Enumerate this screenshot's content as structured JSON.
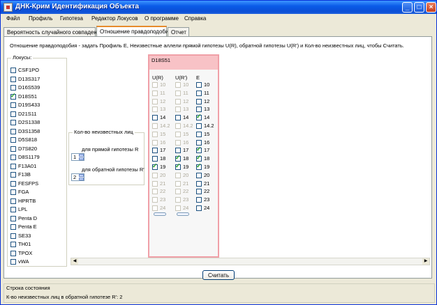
{
  "window": {
    "title": "ДНК-Крим Идентификация Объекта",
    "controls": {
      "minimize": "_",
      "maximize": "□",
      "close": "×"
    }
  },
  "menu": [
    "Файл",
    "Профиль",
    "Гипотеза",
    "Редактор Локусов",
    "О программе",
    "Справка"
  ],
  "tabs": [
    {
      "label": "Вероятность случайного совпадения",
      "active": false
    },
    {
      "label": "Отношение правдоподобия",
      "active": true
    },
    {
      "label": "Отчет",
      "active": false
    }
  ],
  "description": "Отношение правдоподобия - задать Профиль Е, Неизвестные аллели прямой гипотезы U(R), обратной гипотезы U(R') и Кол-во неизвестных лиц, чтобы Считать.",
  "loci": {
    "legend": "Локусы:",
    "items": [
      {
        "label": "CSF1PO",
        "checked": false
      },
      {
        "label": "D13S317",
        "checked": false
      },
      {
        "label": "D16S539",
        "checked": false
      },
      {
        "label": "D18S51",
        "checked": true
      },
      {
        "label": "D19S433",
        "checked": false
      },
      {
        "label": "D21S11",
        "checked": false
      },
      {
        "label": "D2S1338",
        "checked": false
      },
      {
        "label": "D3S1358",
        "checked": false
      },
      {
        "label": "D5S818",
        "checked": false
      },
      {
        "label": "D7S820",
        "checked": false
      },
      {
        "label": "D8S1179",
        "checked": false
      },
      {
        "label": "F13A01",
        "checked": false
      },
      {
        "label": "F13B",
        "checked": false
      },
      {
        "label": "FESFPS",
        "checked": false
      },
      {
        "label": "FGA",
        "checked": false
      },
      {
        "label": "HPRTB",
        "checked": false
      },
      {
        "label": "LPL",
        "checked": false
      },
      {
        "label": "Penta D",
        "checked": false
      },
      {
        "label": "Penta E",
        "checked": false
      },
      {
        "label": "SE33",
        "checked": false
      },
      {
        "label": "TH01",
        "checked": false
      },
      {
        "label": "TPOX",
        "checked": false
      },
      {
        "label": "vWA",
        "checked": false
      }
    ]
  },
  "unknowns": {
    "legend": "Кол-во неизвестных лиц",
    "direct_label": "для прямой гипотезы R",
    "direct_value": "1",
    "reverse_label": "для обратной гипотезы R'",
    "reverse_value": "2"
  },
  "locus_panel": {
    "title": "D18S51",
    "headers": [
      "U(R)",
      "U(R')",
      "E"
    ],
    "rows": [
      {
        "ur": {
          "label": "10",
          "enabled": false,
          "checked": false
        },
        "urp": {
          "label": "10",
          "enabled": false,
          "checked": false
        },
        "e": {
          "label": "10",
          "checked": false
        }
      },
      {
        "ur": {
          "label": "11",
          "enabled": false,
          "checked": false
        },
        "urp": {
          "label": "11",
          "enabled": false,
          "checked": false
        },
        "e": {
          "label": "11",
          "checked": false
        }
      },
      {
        "ur": {
          "label": "12",
          "enabled": false,
          "checked": false
        },
        "urp": {
          "label": "12",
          "enabled": false,
          "checked": false
        },
        "e": {
          "label": "12",
          "checked": false
        }
      },
      {
        "ur": {
          "label": "13",
          "enabled": false,
          "checked": false
        },
        "urp": {
          "label": "13",
          "enabled": false,
          "checked": false
        },
        "e": {
          "label": "13",
          "checked": false
        }
      },
      {
        "ur": {
          "label": "14",
          "enabled": true,
          "checked": false
        },
        "urp": {
          "label": "14",
          "enabled": true,
          "checked": false
        },
        "e": {
          "label": "14",
          "checked": true
        }
      },
      {
        "ur": {
          "label": "14.2",
          "enabled": false,
          "checked": false
        },
        "urp": {
          "label": "14.2",
          "enabled": false,
          "checked": false
        },
        "e": {
          "label": "14.2",
          "checked": false
        }
      },
      {
        "ur": {
          "label": "15",
          "enabled": false,
          "checked": false
        },
        "urp": {
          "label": "15",
          "enabled": false,
          "checked": false
        },
        "e": {
          "label": "15",
          "checked": false
        }
      },
      {
        "ur": {
          "label": "16",
          "enabled": false,
          "checked": false
        },
        "urp": {
          "label": "16",
          "enabled": false,
          "checked": false
        },
        "e": {
          "label": "16",
          "checked": false
        }
      },
      {
        "ur": {
          "label": "17",
          "enabled": true,
          "checked": false
        },
        "urp": {
          "label": "17",
          "enabled": true,
          "checked": false
        },
        "e": {
          "label": "17",
          "checked": true
        }
      },
      {
        "ur": {
          "label": "18",
          "enabled": true,
          "checked": false
        },
        "urp": {
          "label": "18",
          "enabled": true,
          "checked": true
        },
        "e": {
          "label": "18",
          "checked": true
        }
      },
      {
        "ur": {
          "label": "19",
          "enabled": true,
          "checked": true
        },
        "urp": {
          "label": "19",
          "enabled": true,
          "checked": true
        },
        "e": {
          "label": "19",
          "checked": true
        }
      },
      {
        "ur": {
          "label": "20",
          "enabled": false,
          "checked": false
        },
        "urp": {
          "label": "20",
          "enabled": false,
          "checked": false
        },
        "e": {
          "label": "20",
          "checked": false
        }
      },
      {
        "ur": {
          "label": "21",
          "enabled": false,
          "checked": false
        },
        "urp": {
          "label": "21",
          "enabled": false,
          "checked": false
        },
        "e": {
          "label": "21",
          "checked": false
        }
      },
      {
        "ur": {
          "label": "22",
          "enabled": false,
          "checked": false
        },
        "urp": {
          "label": "22",
          "enabled": false,
          "checked": false
        },
        "e": {
          "label": "22",
          "checked": false
        }
      },
      {
        "ur": {
          "label": "23",
          "enabled": false,
          "checked": false
        },
        "urp": {
          "label": "23",
          "enabled": false,
          "checked": false
        },
        "e": {
          "label": "23",
          "checked": false
        }
      },
      {
        "ur": {
          "label": "24",
          "enabled": false,
          "checked": false
        },
        "urp": {
          "label": "24",
          "enabled": false,
          "checked": false
        },
        "e": {
          "label": "24",
          "checked": false
        }
      }
    ]
  },
  "calculate_label": "Считать",
  "status": {
    "title": "Строка состояния",
    "text": "К-во неизвестных лиц в обратной гипотезе R': 2"
  },
  "colors": {
    "titlebar": "#0b4fd6",
    "panel_header": "#f8c2c6",
    "panel_border": "#f0a0a8",
    "check": "#21a121",
    "active_tab_accent": "#e68b2c"
  }
}
